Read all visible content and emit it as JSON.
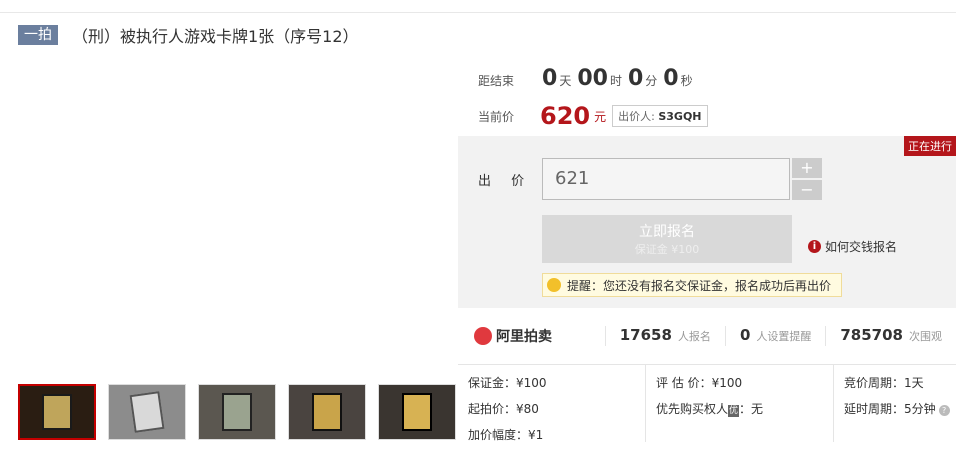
{
  "title": {
    "badge": "一拍",
    "text": "（刑）被执行人游戏卡牌1张（序号12）"
  },
  "countdown": {
    "label": "距结束",
    "days": "0",
    "days_unit": "天",
    "hours": "00",
    "hours_unit": "时",
    "minutes": "0",
    "minutes_unit": "分",
    "seconds": "0",
    "seconds_unit": "秒"
  },
  "current_price": {
    "label": "当前价",
    "value": "620",
    "unit": "元",
    "bidder_label": "出价人:",
    "bidder": "S3GQH"
  },
  "bid": {
    "status": "正在进行",
    "label": "出 价",
    "input_value": "621",
    "plus": "+",
    "minus": "−",
    "signup_label": "立即报名",
    "deposit_label": "保证金 ¥100",
    "howto": "如何交钱报名",
    "reminder": "提醒：您还没有报名交保证金，报名成功后再出价"
  },
  "stats": {
    "logo": "阿里拍卖",
    "signups": "17658",
    "signups_label": "人报名",
    "reminders": "0",
    "reminders_label": "人设置提醒",
    "views": "785708",
    "views_label": "次围观"
  },
  "details": {
    "deposit": "保证金：¥100",
    "start_price": "起拍价：¥80",
    "increment": "加价幅度：¥1",
    "appraisal": "评 估 价：¥100",
    "priority_label": "优先购买权人",
    "priority_tag": "优",
    "priority_value": "：无",
    "cycle": "竞价周期：1天",
    "delay": "延时周期：5分钟"
  }
}
